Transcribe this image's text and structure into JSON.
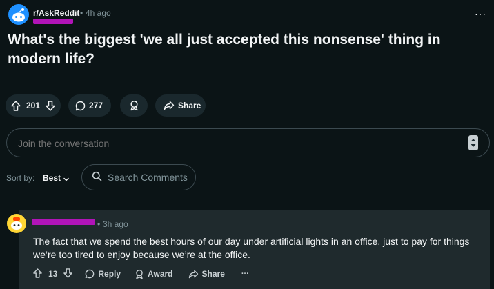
{
  "post": {
    "subreddit": "r/AskReddit",
    "dot": "•",
    "time": "4h ago",
    "title": "What's the biggest 'we all just accepted this nonsense' thing in modern life?",
    "more": "···",
    "votes": "201",
    "comments": "277",
    "share_label": "Share"
  },
  "join": {
    "placeholder": "Join the conversation"
  },
  "sort": {
    "label": "Sort by:",
    "value": "Best"
  },
  "search": {
    "placeholder": "Search Comments"
  },
  "comment": {
    "dot": "•",
    "time": "3h ago",
    "text": "The fact that we spend the best hours of our day under artificial lights in an office, just to pay for things we’re too tired to enjoy because we’re at the office.",
    "votes": "13",
    "reply_label": "Reply",
    "award_label": "Award",
    "share_label": "Share",
    "more": "···"
  },
  "colors": {
    "background": "#0b1416",
    "pill": "#1a282d",
    "comment_bg": "#1f2a2d",
    "muted": "#82959b",
    "redaction": "#b114b8",
    "subreddit_icon": "#1e90ff"
  }
}
